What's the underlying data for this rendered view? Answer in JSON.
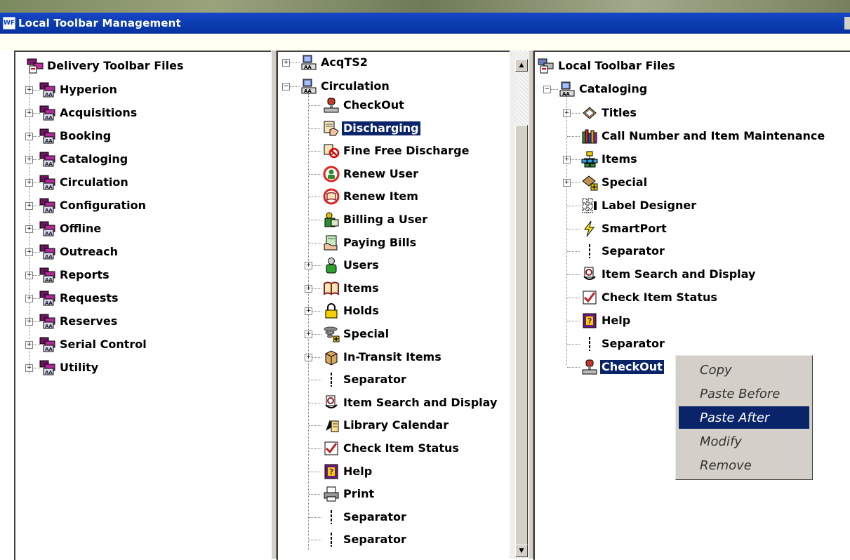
{
  "window": {
    "title": "Local Toolbar Management",
    "logo": "WF"
  },
  "left_panel": {
    "root": "Delivery Toolbar Files",
    "items": [
      "Hyperion",
      "Acquisitions",
      "Booking",
      "Cataloging",
      "Circulation",
      "Configuration",
      "Offline",
      "Outreach",
      "Reports",
      "Requests",
      "Reserves",
      "Serial Control",
      "Utility"
    ]
  },
  "middle_panel": {
    "acq": "AcqTS2",
    "circ": "Circulation",
    "items": [
      {
        "label": "CheckOut",
        "icon": "stamp-icon",
        "expand": false
      },
      {
        "label": "Discharging",
        "icon": "discharge-icon",
        "expand": false,
        "selected": true
      },
      {
        "label": "Fine Free Discharge",
        "icon": "fine-free-icon",
        "expand": false
      },
      {
        "label": "Renew User",
        "icon": "renew-user-icon",
        "expand": false
      },
      {
        "label": "Renew Item",
        "icon": "renew-item-icon",
        "expand": false
      },
      {
        "label": "Billing a User",
        "icon": "billing-icon",
        "expand": false
      },
      {
        "label": "Paying Bills",
        "icon": "paying-icon",
        "expand": false
      },
      {
        "label": "Users",
        "icon": "user-icon",
        "expand": true
      },
      {
        "label": "Items",
        "icon": "book-icon",
        "expand": true
      },
      {
        "label": "Holds",
        "icon": "lock-icon",
        "expand": true
      },
      {
        "label": "Special",
        "icon": "tornado-icon",
        "expand": true
      },
      {
        "label": "In-Transit Items",
        "icon": "box-icon",
        "expand": true
      },
      {
        "label": "Separator",
        "icon": "separator-icon",
        "expand": false
      },
      {
        "label": "Item Search and Display",
        "icon": "item-search-icon",
        "expand": false
      },
      {
        "label": "Library Calendar",
        "icon": "calendar-icon",
        "expand": false
      },
      {
        "label": "Check Item Status",
        "icon": "check-status-icon",
        "expand": false
      },
      {
        "label": "Help",
        "icon": "help-icon",
        "expand": false
      },
      {
        "label": "Print",
        "icon": "printer-icon",
        "expand": false
      },
      {
        "label": "Separator",
        "icon": "separator-icon",
        "expand": false
      },
      {
        "label": "Separator",
        "icon": "separator-icon",
        "expand": false
      }
    ]
  },
  "right_panel": {
    "root": "Local Toolbar Files",
    "cat": "Cataloging",
    "items": [
      {
        "label": "Titles",
        "icon": "titles-icon",
        "expand": true
      },
      {
        "label": "Call Number and Item Maintenance",
        "icon": "call-number-icon",
        "expand": false
      },
      {
        "label": "Items",
        "icon": "items-tree-icon",
        "expand": true
      },
      {
        "label": "Special",
        "icon": "special-icon",
        "expand": true
      },
      {
        "label": "Label Designer",
        "icon": "label-designer-icon",
        "expand": false
      },
      {
        "label": "SmartPort",
        "icon": "lightning-icon",
        "expand": false
      },
      {
        "label": "Separator",
        "icon": "separator-icon",
        "expand": false
      },
      {
        "label": "Item Search and Display",
        "icon": "item-search-icon",
        "expand": false
      },
      {
        "label": "Check Item Status",
        "icon": "check-status-icon",
        "expand": false
      },
      {
        "label": "Help",
        "icon": "help-icon",
        "expand": false
      },
      {
        "label": "Separator",
        "icon": "separator-icon",
        "expand": false
      },
      {
        "label": "CheckOut",
        "icon": "stamp-icon",
        "expand": false,
        "selected": true
      }
    ]
  },
  "context_menu": {
    "items": [
      "Copy",
      "Paste Before",
      "Paste After",
      "Modify",
      "Remove"
    ],
    "highlighted": "Paste After"
  },
  "colors": {
    "selection": "#0a246a",
    "titlebar": "#0a3db0",
    "panel_bg": "#ffffff",
    "chrome": "#d4d0c8"
  }
}
